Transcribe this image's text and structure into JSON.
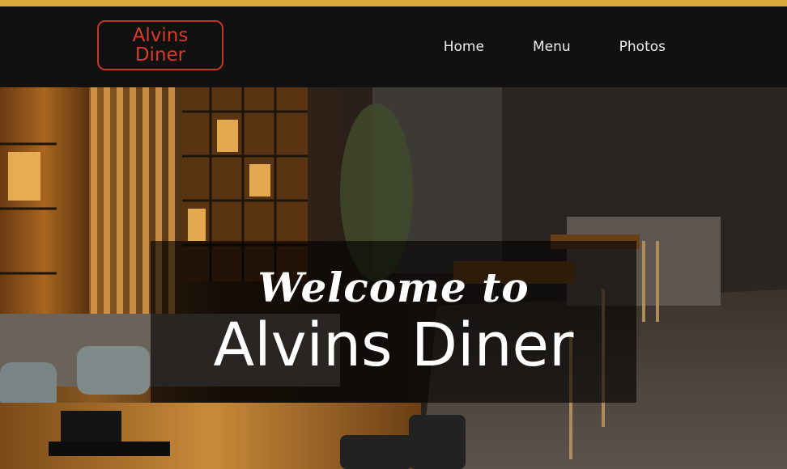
{
  "brand": {
    "logo_line1": "Alvins",
    "logo_line2": "Diner",
    "accent_color": "#d93a2b",
    "top_strip_color": "#d7a83a"
  },
  "nav": {
    "items": [
      {
        "label": "Home"
      },
      {
        "label": "Menu"
      },
      {
        "label": "Photos"
      }
    ]
  },
  "hero": {
    "welcome_line": "Welcome to",
    "title": "Alvins Diner",
    "image_subject": "restaurant-interior-photo"
  }
}
